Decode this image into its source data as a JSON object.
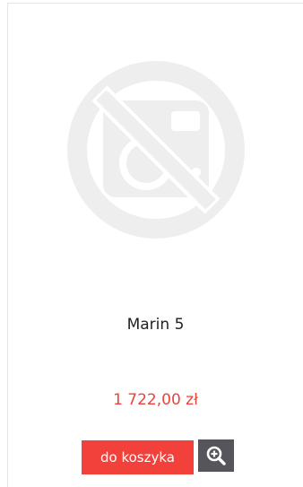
{
  "product": {
    "name": "Marin 5",
    "price": "1 722,00 zł",
    "image_icon": "no-photo-icon"
  },
  "actions": {
    "add_to_cart_label": "do koszyka",
    "zoom_icon": "zoom-in-icon"
  },
  "colors": {
    "price": "#e8443a",
    "cart_button": "#f2413b",
    "zoom_button": "#55555b",
    "placeholder_icon": "#eeeeee"
  }
}
